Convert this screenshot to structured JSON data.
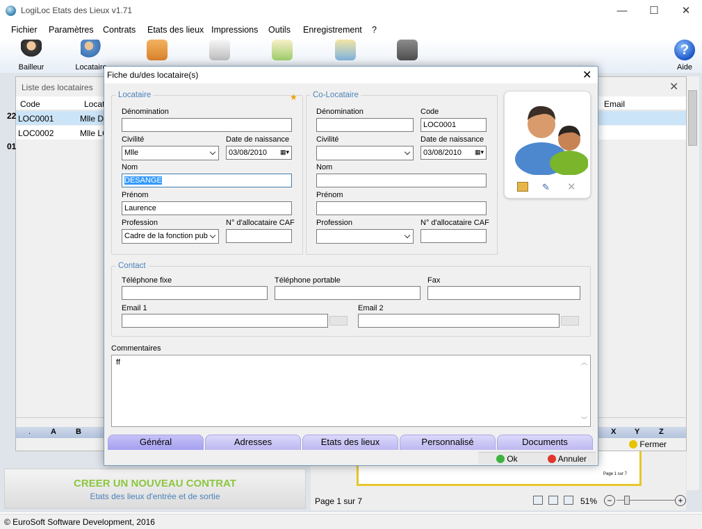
{
  "app": {
    "title": "LogiLoc Etats des Lieux v1.71",
    "min": "—",
    "max": "☐",
    "close": "✕"
  },
  "menu": [
    "Fichier",
    "Paramètres",
    "Contrats",
    "Etats des lieux",
    "Impressions",
    "Outils",
    "Enregistrement",
    "?"
  ],
  "toolbar": {
    "bailleur": "Bailleur",
    "locataire": "Locataire",
    "aide": "Aide"
  },
  "list": {
    "title": "Liste des locataires",
    "col_code": "Code",
    "col_loc": "Locata",
    "col_email": "Email",
    "rows": [
      {
        "code": "LOC0001",
        "name": "Mlle DI"
      },
      {
        "code": "LOC0002",
        "name": "Mlle LC"
      }
    ],
    "side": [
      "22",
      "01"
    ],
    "letters": [
      ".",
      "A",
      "B",
      "X",
      "Y",
      "Z"
    ],
    "fermer": "Fermer"
  },
  "bottom": {
    "create": "CREER UN NOUVEAU CONTRAT",
    "sub": "Etats des lieux d'entrée et de sortie",
    "page": "Page 1 sur 7",
    "zoom": "51%",
    "preview_page": "Page 1 sur 7"
  },
  "status": "© EuroSoft Software Development, 2016",
  "dialog": {
    "title": "Fiche du/des locataire(s)",
    "close": "✕",
    "locataire": {
      "legend": "Locataire",
      "denomination_label": "Dénomination",
      "denomination": "",
      "civilite_label": "Civilité",
      "civilite": "Mlle",
      "dob_label": "Date de naissance",
      "dob": "03/08/2010",
      "nom_label": "Nom",
      "nom": "DESANGE",
      "prenom_label": "Prénom",
      "prenom": "Laurence",
      "profession_label": "Profession",
      "profession": "Cadre de la fonction pub",
      "caf_label": "N° d'allocataire CAF",
      "caf": ""
    },
    "colocataire": {
      "legend": "Co-Locataire",
      "denomination_label": "Dénomination",
      "denomination": "",
      "code_label": "Code",
      "code": "LOC0001",
      "civilite_label": "Civilité",
      "civilite": "",
      "dob_label": "Date de naissance",
      "dob": "03/08/2010",
      "nom_label": "Nom",
      "nom": "",
      "prenom_label": "Prénom",
      "prenom": "",
      "profession_label": "Profession",
      "profession": "",
      "caf_label": "N° d'allocataire CAF",
      "caf": ""
    },
    "contact": {
      "legend": "Contact",
      "tel_fixe_label": "Téléphone fixe",
      "tel_port_label": "Téléphone portable",
      "fax_label": "Fax",
      "email1_label": "Email 1",
      "email2_label": "Email 2"
    },
    "comments": {
      "label": "Commentaires",
      "value": "ff"
    },
    "tabs": [
      "Général",
      "Adresses",
      "Etats des lieux",
      "Personnalisé",
      "Documents"
    ],
    "ok": "Ok",
    "cancel": "Annuler"
  }
}
